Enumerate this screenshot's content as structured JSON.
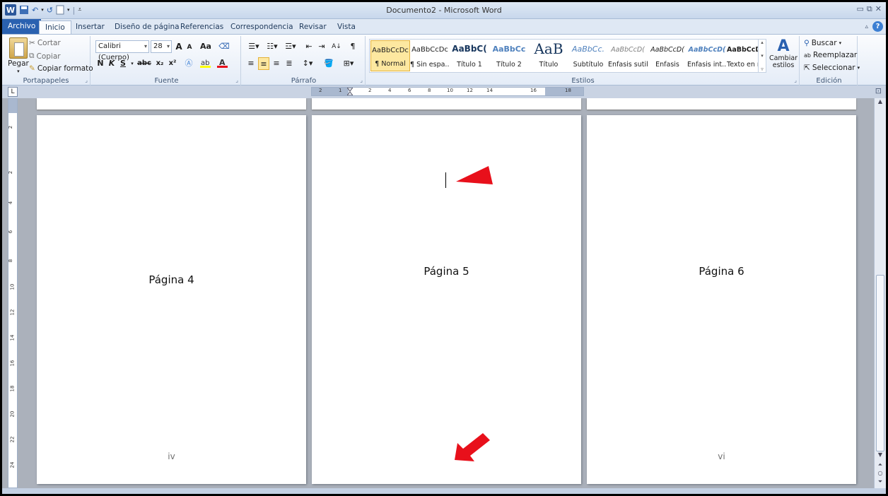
{
  "window": {
    "title": "Documento2 - Microsoft Word",
    "logo_letter": "W"
  },
  "tabs": [
    "Archivo",
    "Inicio",
    "Insertar",
    "Diseño de página",
    "Referencias",
    "Correspondencia",
    "Revisar",
    "Vista"
  ],
  "help_symbol": "?",
  "clipboard": {
    "paste": "Pegar",
    "cut": "Cortar",
    "copy": "Copiar",
    "format_painter": "Copiar formato",
    "label": "Portapapeles"
  },
  "font": {
    "name": "Calibri (Cuerpo)",
    "size": "28",
    "label": "Fuente",
    "bold": "N",
    "italic": "K",
    "underline": "S",
    "strike": "abc",
    "subscript": "x₂",
    "superscript": "x²",
    "grow": "A",
    "shrink": "A",
    "case": "Aa"
  },
  "paragraph": {
    "label": "Párrafo",
    "show_marks": "¶",
    "sort": "A↓"
  },
  "styles": {
    "label": "Estilos",
    "items": [
      {
        "sample": "AaBbCcDc",
        "name": "¶ Normal"
      },
      {
        "sample": "AaBbCcDc",
        "name": "¶ Sin espa..."
      },
      {
        "sample": "AaBbC(",
        "name": "Título 1"
      },
      {
        "sample": "AaBbCc",
        "name": "Título 2"
      },
      {
        "sample": "AaB",
        "name": "Título"
      },
      {
        "sample": "AaBbCc.",
        "name": "Subtítulo"
      },
      {
        "sample": "AaBbCcD(",
        "name": "Énfasis sutil"
      },
      {
        "sample": "AaBbCcD(",
        "name": "Énfasis"
      },
      {
        "sample": "AaBbCcD(",
        "name": "Énfasis int..."
      },
      {
        "sample": "AaBbCcDc",
        "name": "Texto en n..."
      }
    ],
    "change": "Cambiar estilos"
  },
  "editing": {
    "label": "Edición",
    "find": "Buscar",
    "replace": "Reemplazar",
    "select": "Seleccionar"
  },
  "ruler": {
    "h_numbers": [
      "2",
      "1",
      "2",
      "4",
      "6",
      "8",
      "10",
      "12",
      "14",
      "16",
      "18"
    ],
    "v_numbers": [
      "2",
      "2",
      "4",
      "6",
      "8",
      "10",
      "12",
      "14",
      "16",
      "18",
      "20",
      "22",
      "24"
    ]
  },
  "pages": [
    {
      "title": "Página 4",
      "number": "iv"
    },
    {
      "title": "Página 5",
      "number": ""
    },
    {
      "title": "Página 6",
      "number": "vi"
    }
  ],
  "colors": {
    "file_tab": "#2a61b0",
    "annotation_arrow": "#e8101b",
    "page_bg": "#ffffff",
    "workspace_bg": "#abb1bb"
  }
}
